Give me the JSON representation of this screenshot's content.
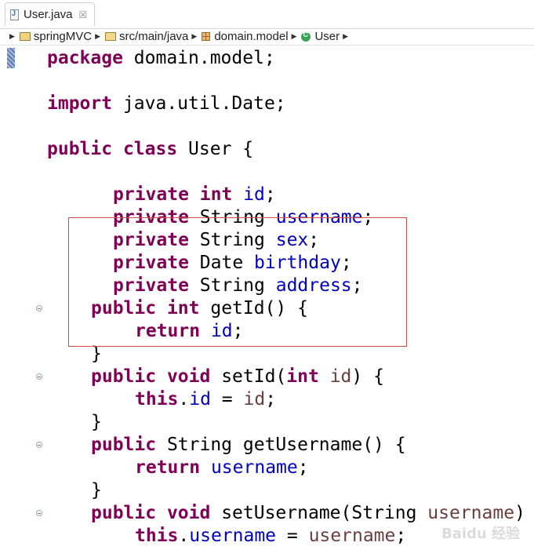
{
  "tab": {
    "label": "User.java",
    "close_glyph": "☒"
  },
  "breadcrumb": [
    {
      "label": "springMVC",
      "icon": "project-icon"
    },
    {
      "label": "src/main/java",
      "icon": "source-folder-icon"
    },
    {
      "label": "domain.model",
      "icon": "package-icon"
    },
    {
      "label": "User",
      "icon": "class-icon"
    }
  ],
  "code": {
    "l1": {
      "kw": "package",
      "rest": " domain.model;"
    },
    "l3": {
      "kw": "import",
      "rest": " java.util.Date;"
    },
    "l5": {
      "kw1": "public",
      "kw2": "class",
      "rest": " User {"
    },
    "f1": {
      "kw1": "private",
      "kw2": "int",
      "name": "id",
      "end": ";"
    },
    "f2": {
      "kw1": "private",
      "type": " String ",
      "name": "username",
      "end": ";"
    },
    "f3": {
      "kw1": "private",
      "type": " String ",
      "name": "sex",
      "end": ";"
    },
    "f4": {
      "kw1": "private",
      "type": " Date ",
      "name": "birthday",
      "end": ";"
    },
    "f5": {
      "kw1": "private",
      "type": " String ",
      "name": "address",
      "end": ";"
    },
    "m1": {
      "kw1": "public",
      "kw2": "int",
      "rest": " getId() {"
    },
    "m1b": {
      "kw": "return",
      "name": "id",
      "end": ";"
    },
    "m1c": "}",
    "m2": {
      "kw1": "public",
      "kw2": "void",
      "mid": " setId(",
      "kw3": "int",
      "param": "id",
      "end": ") {"
    },
    "m2b": {
      "kw": "this",
      "dot": ".",
      "name": "id",
      "eq": " = ",
      "param": "id",
      "end": ";"
    },
    "m2c": "}",
    "m3": {
      "kw1": "public",
      "rest": " String getUsername() {"
    },
    "m3b": {
      "kw": "return",
      "name": "username",
      "end": ";"
    },
    "m3c": "}",
    "m4": {
      "kw1": "public",
      "kw2": "void",
      "mid": " setUsername(String ",
      "param": "username",
      "end": ")"
    },
    "m4b": {
      "kw": "this",
      "dot": ".",
      "name": "username",
      "eq": " = ",
      "param": "username",
      "end": ";"
    }
  },
  "watermark": "Baidu 经验"
}
